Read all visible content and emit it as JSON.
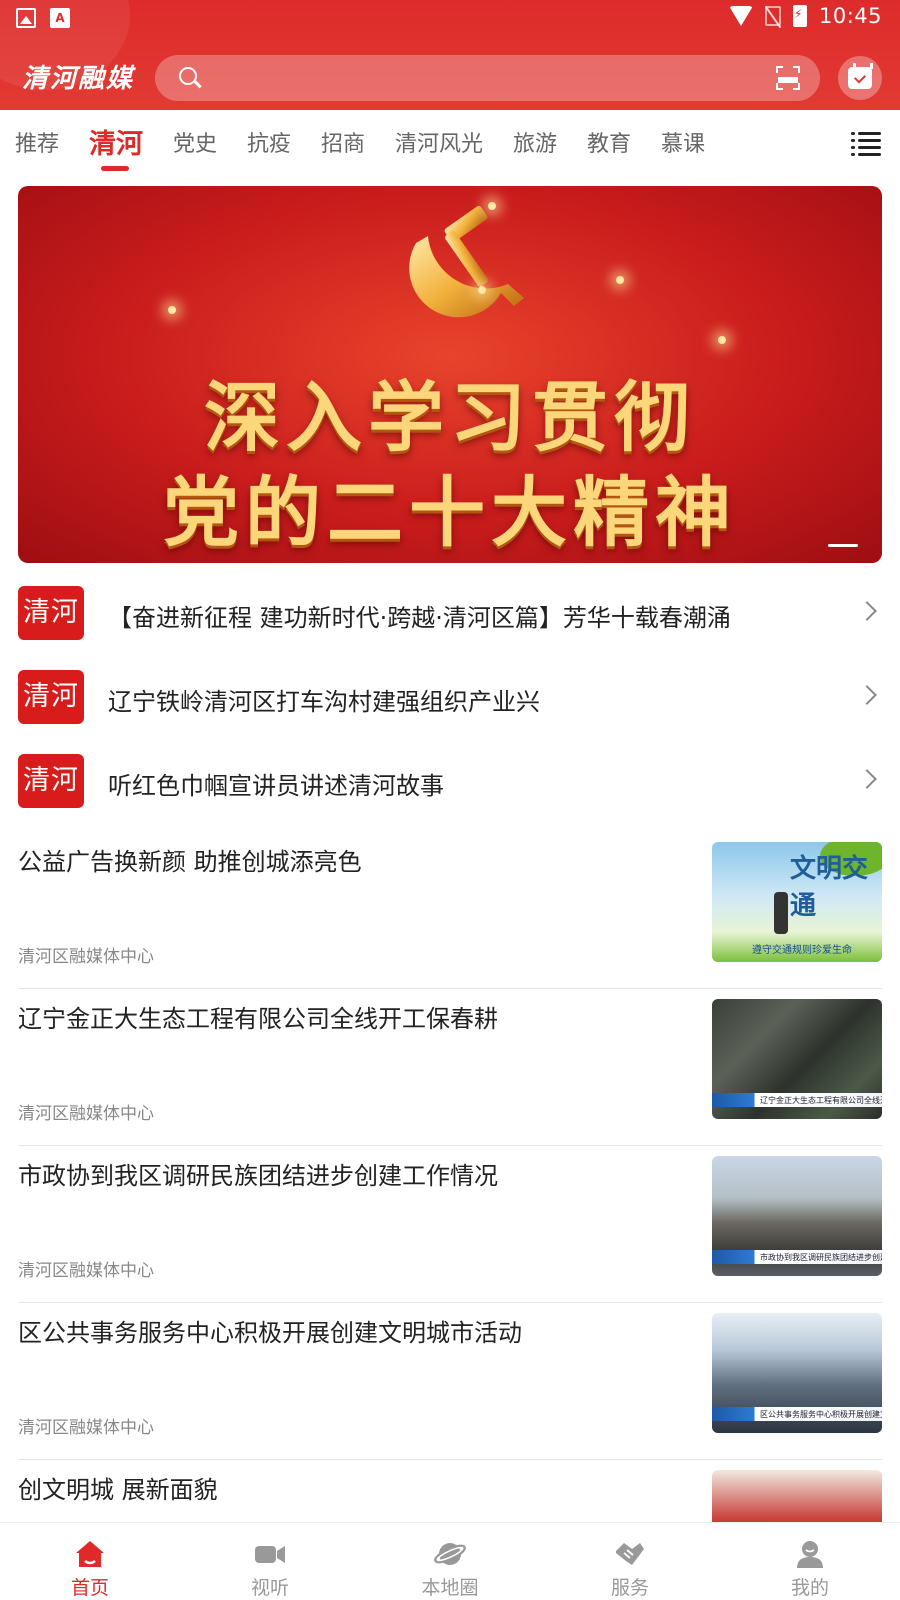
{
  "status_bar": {
    "time": "10:45"
  },
  "header": {
    "logo": "清河融媒",
    "search": {
      "placeholder": "",
      "value": ""
    }
  },
  "tabs": [
    {
      "label": "推荐",
      "active": false
    },
    {
      "label": "清河",
      "active": true
    },
    {
      "label": "党史",
      "active": false
    },
    {
      "label": "抗疫",
      "active": false
    },
    {
      "label": "招商",
      "active": false
    },
    {
      "label": "清河风光",
      "active": false
    },
    {
      "label": "旅游",
      "active": false
    },
    {
      "label": "教育",
      "active": false
    },
    {
      "label": "慕课",
      "active": false
    }
  ],
  "banner": {
    "line1": "深入学习贯彻",
    "line2": "党的二十大精神"
  },
  "headlines": [
    {
      "badge": "清河",
      "title": "【奋进新征程 建功新时代·跨越·清河区篇】芳华十载春潮涌"
    },
    {
      "badge": "清河",
      "title": "辽宁铁岭清河区打车沟村建强组织产业兴"
    },
    {
      "badge": "清河",
      "title": "听红色巾帼宣讲员讲述清河故事"
    }
  ],
  "news": [
    {
      "title": "公益广告换新颜 助推创城添亮色",
      "source": "清河区融媒体中心",
      "thumb": {
        "heading": "文明交通",
        "caption": "遵守交通规则珍爱生命"
      }
    },
    {
      "title": "辽宁金正大生态工程有限公司全线开工保春耕",
      "source": "清河区融媒体中心",
      "thumb": {
        "caption": "辽宁金正大生态工程有限公司全线开工保春耕"
      }
    },
    {
      "title": "市政协到我区调研民族团结进步创建工作情况",
      "source": "清河区融媒体中心",
      "thumb": {
        "caption": "市政协到我区调研民族团结进步创建工作情况"
      }
    },
    {
      "title": "区公共事务服务中心积极开展创建文明城市活动",
      "source": "清河区融媒体中心",
      "thumb": {
        "caption": "区公共事务服务中心积极开展创建文明城市活动"
      }
    },
    {
      "title": "创文明城  展新面貌",
      "source": "",
      "thumb": {
        "caption": ""
      }
    }
  ],
  "bottom_nav": [
    {
      "label": "首页",
      "icon": "home-icon",
      "active": true
    },
    {
      "label": "视听",
      "icon": "video-camera-icon",
      "active": false
    },
    {
      "label": "本地圈",
      "icon": "planet-icon",
      "active": false
    },
    {
      "label": "服务",
      "icon": "handshake-icon",
      "active": false
    },
    {
      "label": "我的",
      "icon": "user-icon",
      "active": false
    }
  ],
  "colors": {
    "brand_red": "#e02a2a",
    "inactive_gray": "#999999"
  }
}
